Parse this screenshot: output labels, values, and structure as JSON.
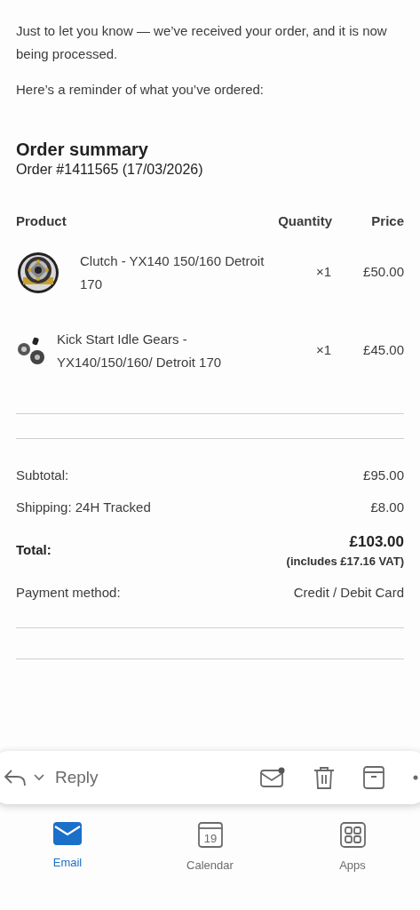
{
  "intro": [
    "Just to let you know — we’ve received your order, and it is now being processed.",
    "Here’s a reminder of what you’ve ordered:"
  ],
  "summary": {
    "title": "Order summary",
    "order": "Order #1411565 (17/03/2026)"
  },
  "table": {
    "columns": [
      "Product",
      "Quantity",
      "Price"
    ],
    "rows": [
      {
        "kind": "picture",
        "product": "Clutch - YX140 150/160 Detroit 170",
        "quantity": "×1",
        "price": "£50.00"
      },
      {
        "kind": "picture",
        "product": "Kick Start Idle Gears - YX140/150/160/ Detroit 170",
        "quantity": "×1",
        "price": "£45.00"
      }
    ]
  },
  "totals": [
    {
      "label": "Subtotal:",
      "value": "£95.00"
    },
    {
      "label": "Shipping: 24H Tracked",
      "value": "£8.00"
    },
    {
      "label": "Total:",
      "value": "£103.00",
      "note": "(includes £17.16 VAT)"
    },
    {
      "label": "Payment method:",
      "value": "Credit / Debit Card"
    }
  ],
  "reply_bar": {
    "label": "Reply"
  },
  "tabs": [
    {
      "label": "Email",
      "selected": true,
      "kind": "email"
    },
    {
      "label": "Calendar",
      "selected": false,
      "kind": "calendar",
      "day": "19"
    },
    {
      "label": "Apps",
      "selected": false,
      "kind": "apps"
    }
  ]
}
